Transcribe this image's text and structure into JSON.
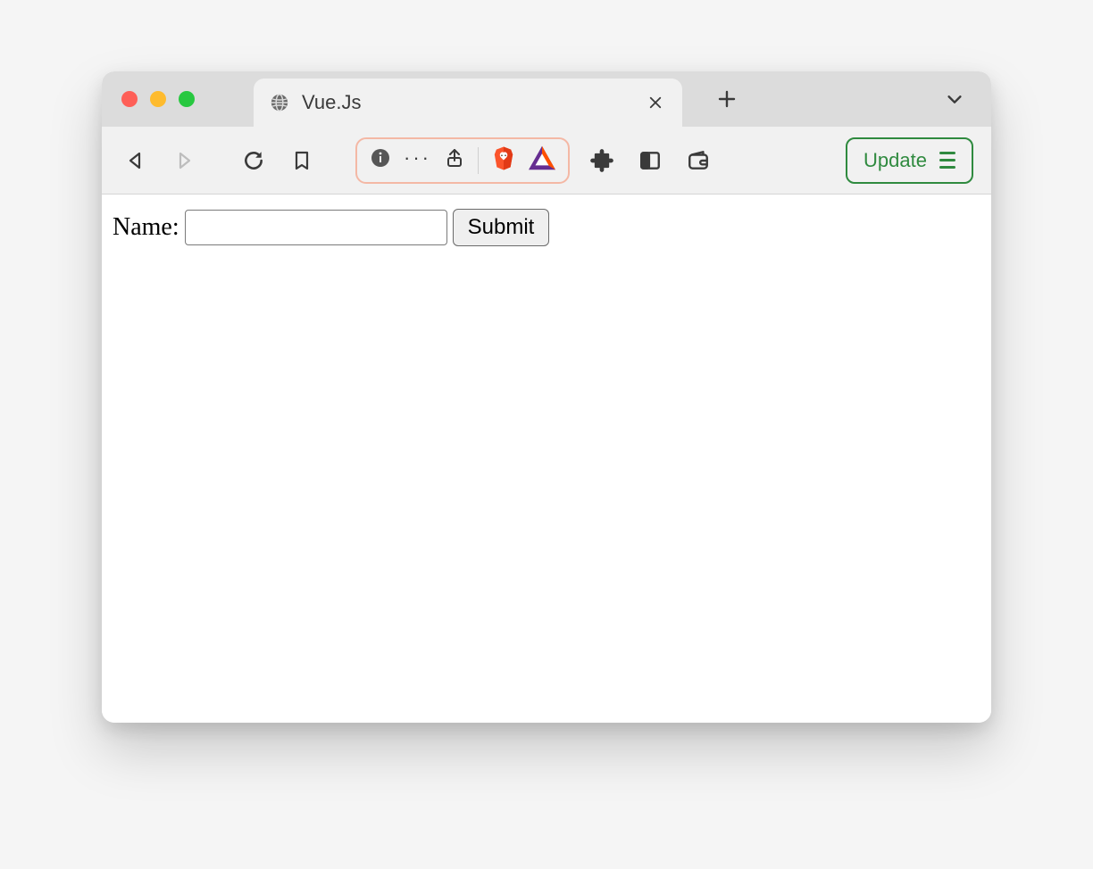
{
  "window": {
    "tab_title": "Vue.Js",
    "update_label": "Update"
  },
  "page": {
    "name_label": "Name:",
    "name_value": "",
    "name_placeholder": "",
    "submit_label": "Submit"
  },
  "icons": {
    "close": "close-icon",
    "globe": "globe-icon",
    "plus": "plus-icon",
    "chevron": "chevron-down-icon",
    "back": "back-icon",
    "forward": "forward-icon",
    "reload": "reload-icon",
    "bookmark": "bookmark-icon",
    "info": "info-icon",
    "more": "more-icon",
    "share": "share-icon",
    "shield": "brave-shield-icon",
    "bat": "bat-token-icon",
    "extensions": "extensions-icon",
    "sidebar": "sidebar-panel-icon",
    "wallet": "wallet-icon",
    "menu": "hamburger-menu-icon"
  }
}
